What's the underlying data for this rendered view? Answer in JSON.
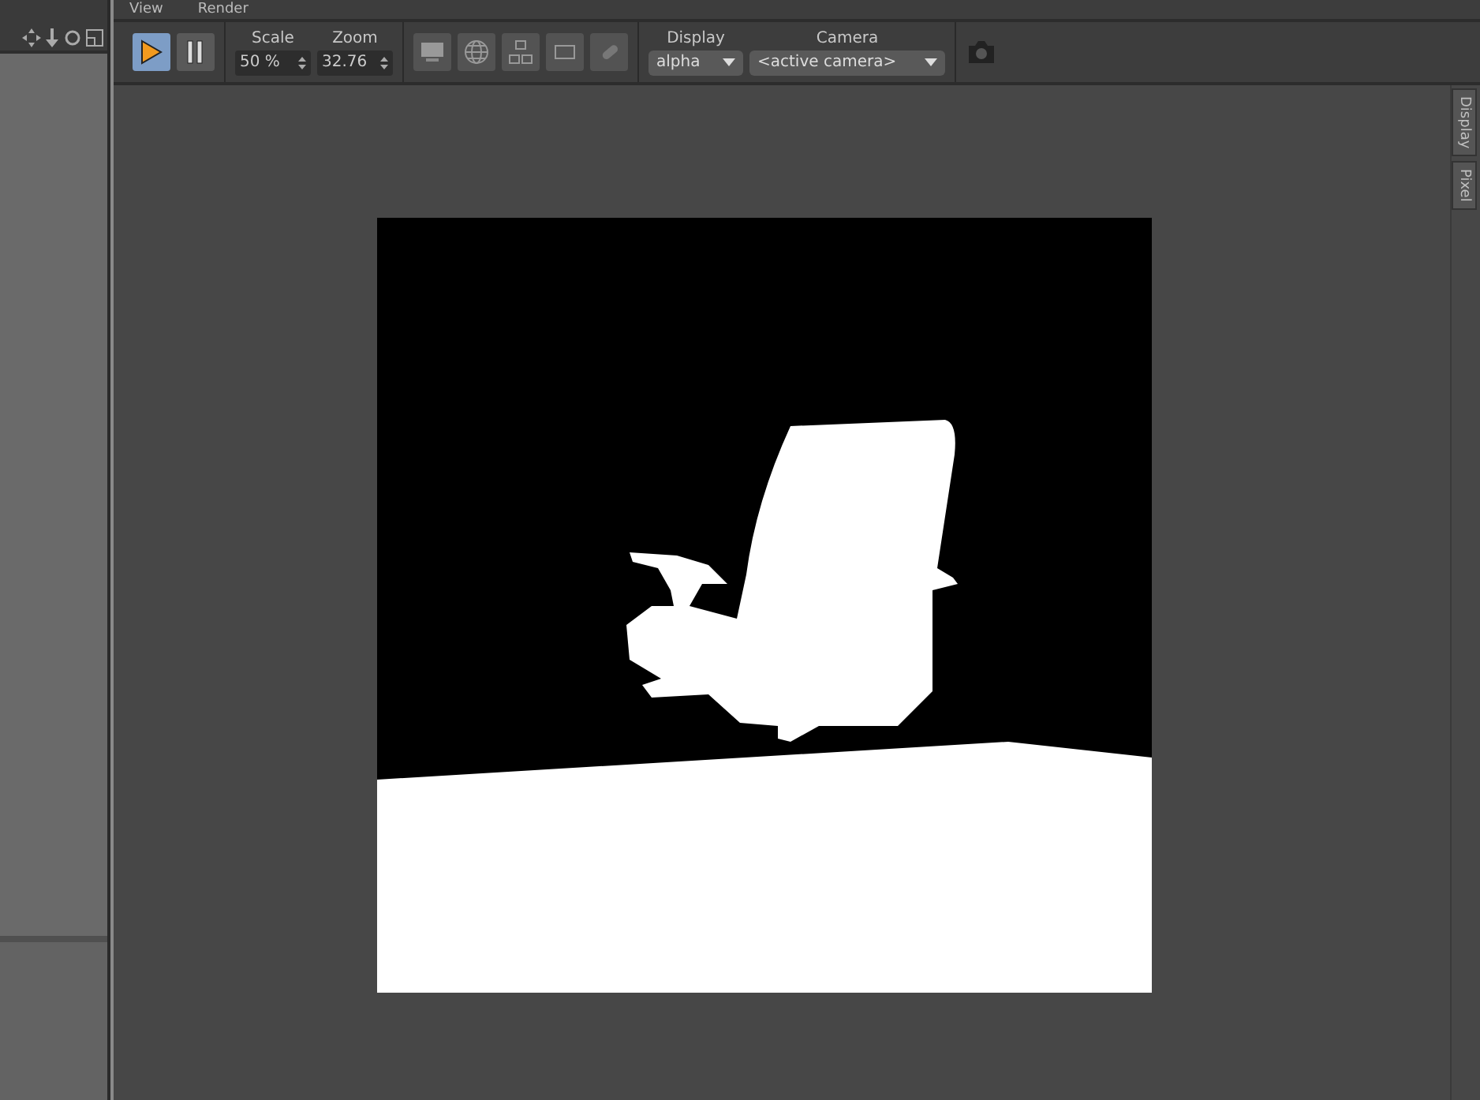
{
  "menu": [
    "View",
    "Render"
  ],
  "playback": [
    {
      "kind": "play",
      "selected": true
    },
    {
      "kind": "pause",
      "selected": false
    }
  ],
  "scale": {
    "label": "Scale",
    "value": "50 %"
  },
  "zoom": {
    "label": "Zoom",
    "value": "32.76"
  },
  "view_buttons": [
    {
      "kind": "monitor"
    },
    {
      "kind": "globe"
    },
    {
      "kind": "hierarchy"
    },
    {
      "kind": "frame"
    },
    {
      "kind": "capsule"
    }
  ],
  "display": {
    "label": "Display",
    "value": "alpha"
  },
  "camera": {
    "label": "Camera",
    "value": "<active camera>"
  },
  "side_tabs": [
    {
      "label": "Display"
    },
    {
      "label": "Pixel"
    }
  ]
}
